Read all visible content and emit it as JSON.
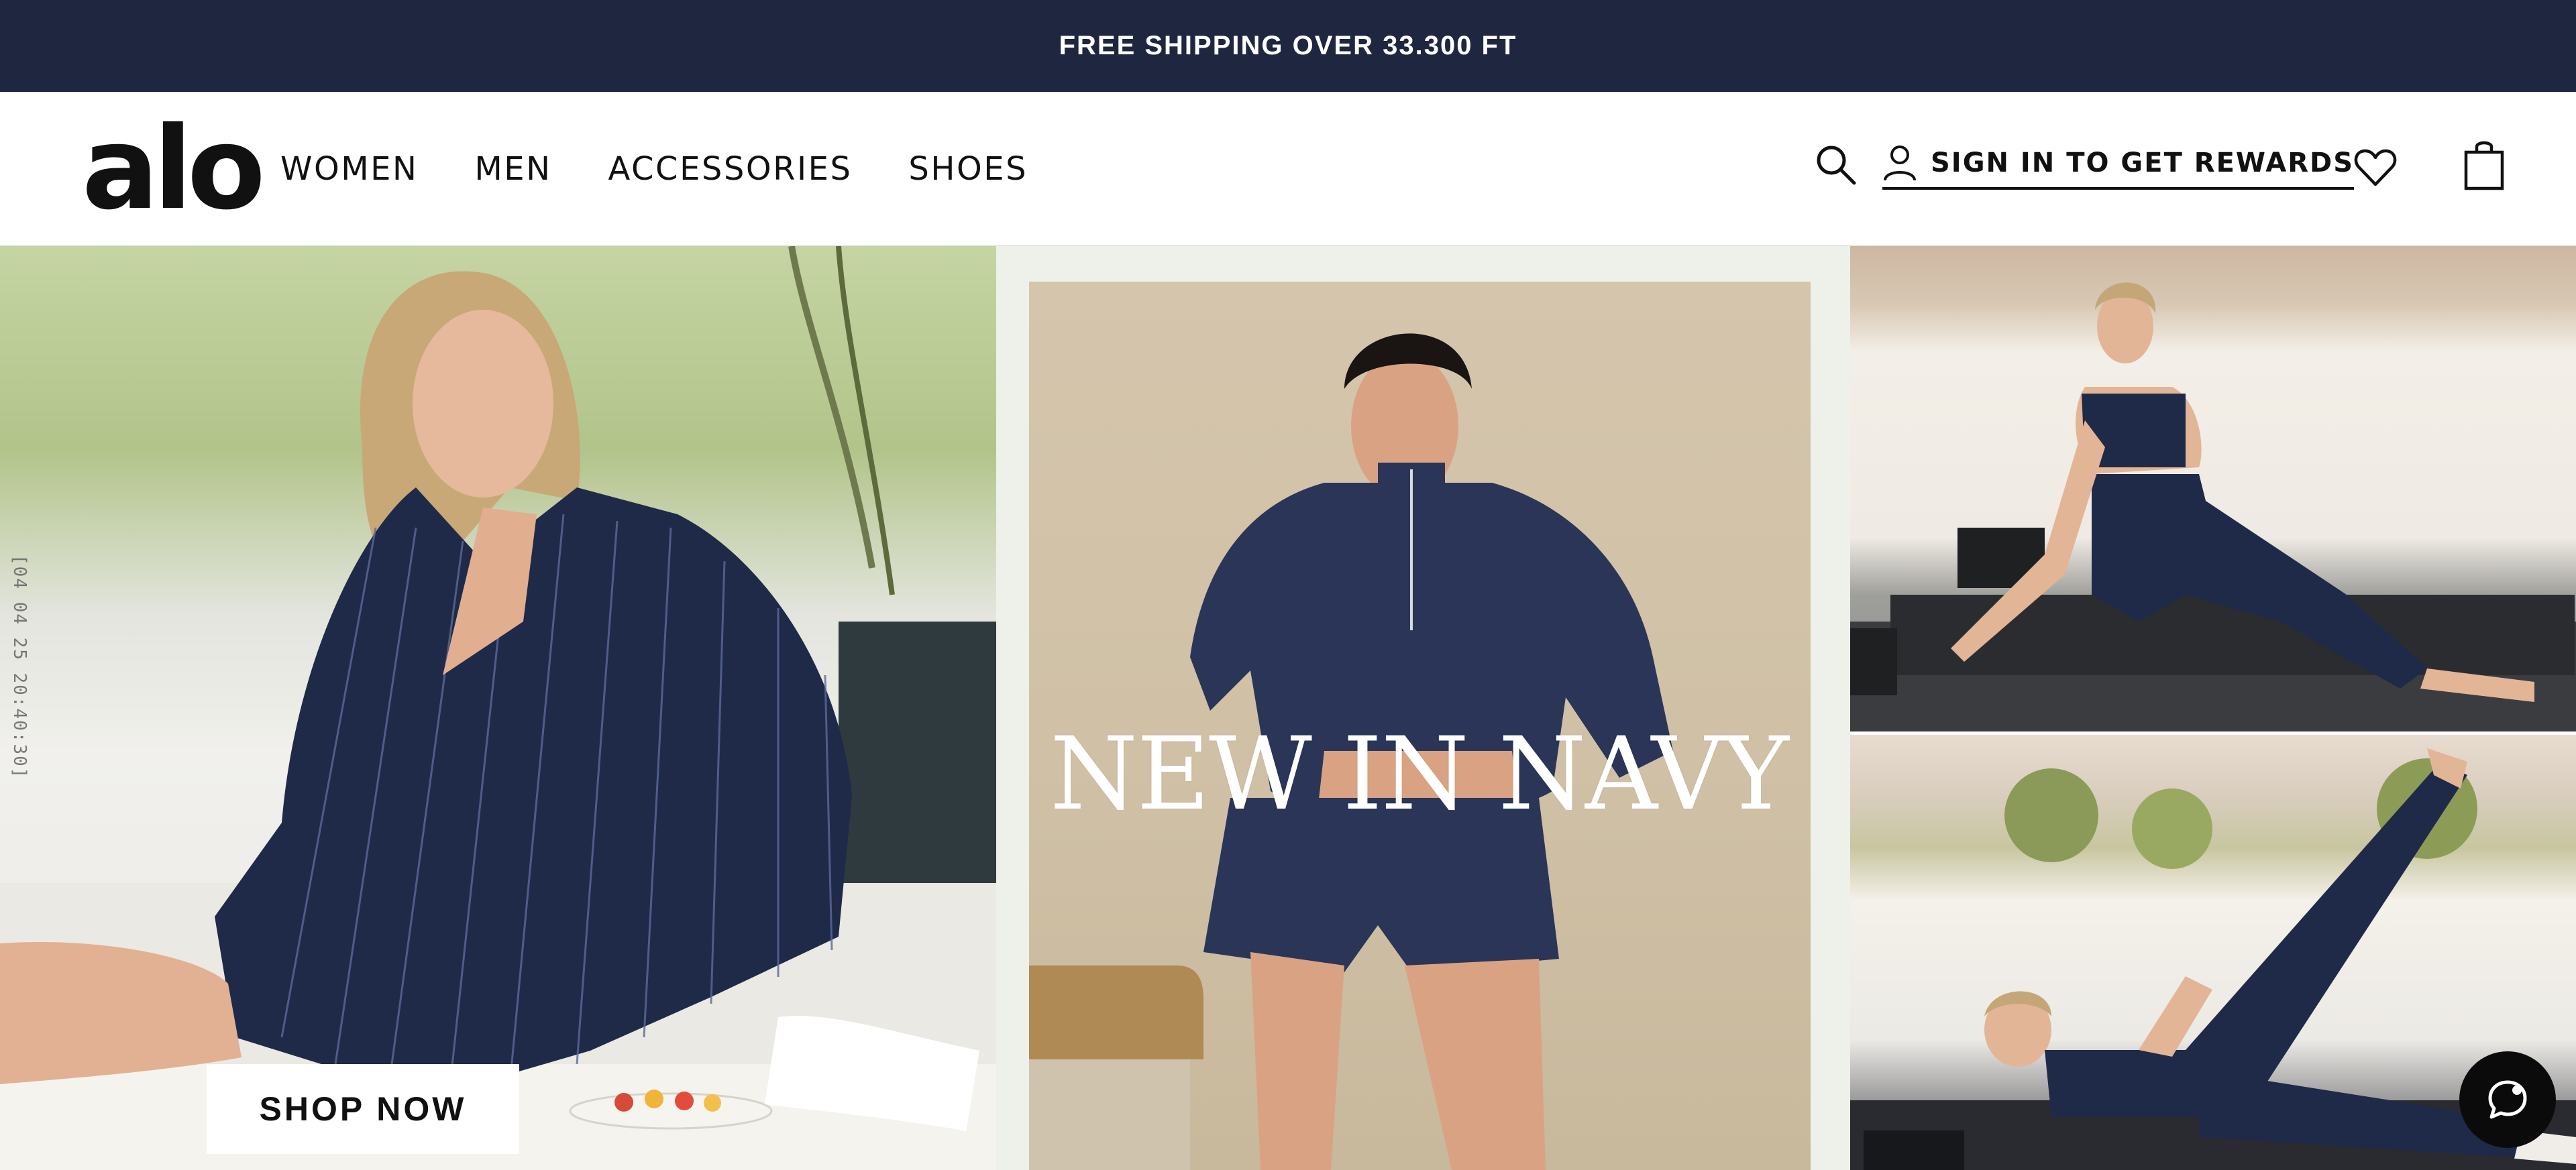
{
  "promo": {
    "text": "FREE SHIPPING OVER 33.300 FT"
  },
  "header": {
    "logo": "alo",
    "nav": [
      {
        "label": "WOMEN"
      },
      {
        "label": "MEN"
      },
      {
        "label": "ACCESSORIES"
      },
      {
        "label": "SHOES"
      }
    ],
    "signin_label": "SIGN IN TO GET REWARDS",
    "icons": [
      "search-icon",
      "user-icon",
      "heart-icon",
      "bag-icon"
    ]
  },
  "hero": {
    "timestamp": "[04 04 25  20:40:30]",
    "headline_left": "NEW",
    "headline_right": "IN NAVY",
    "cta_label": "SHOP NOW"
  },
  "chat": {
    "icon": "chat-icon"
  },
  "colors": {
    "promo_bg": "#1f2640",
    "navy": "#1f2a48",
    "text": "#111111"
  }
}
